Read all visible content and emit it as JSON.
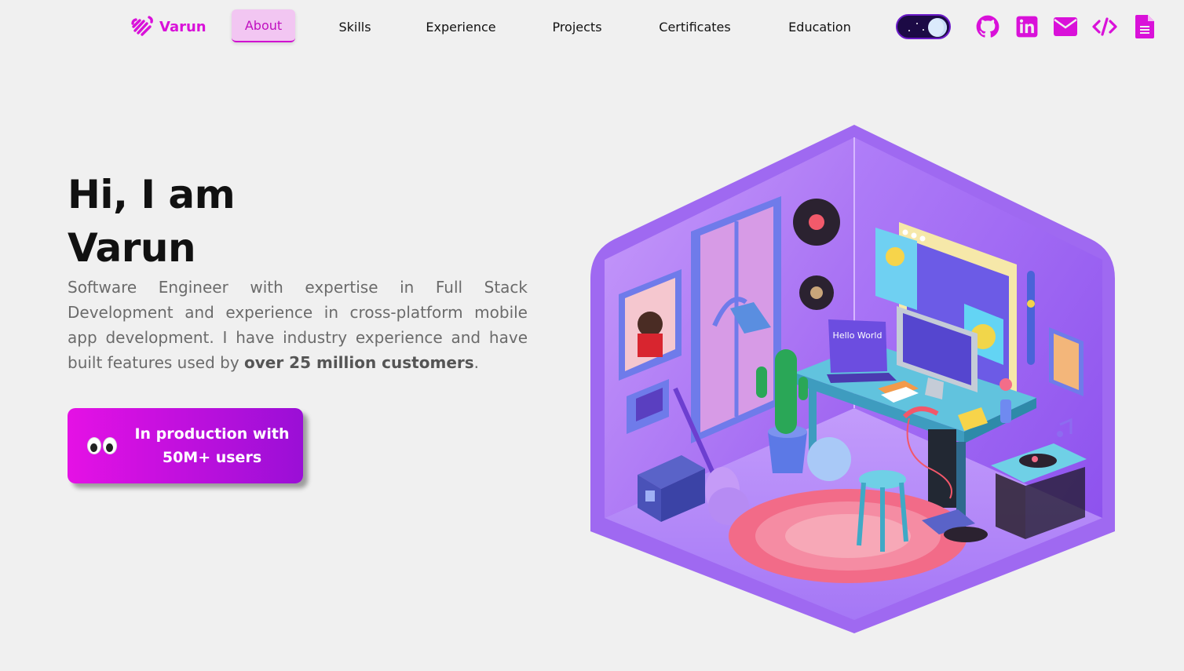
{
  "nav": {
    "logo_text": "Varun",
    "links": [
      {
        "label": "About",
        "active": true
      },
      {
        "label": "Skills"
      },
      {
        "label": "Experience"
      },
      {
        "label": "Projects"
      },
      {
        "label": "Certificates"
      },
      {
        "label": "Education"
      }
    ],
    "theme_toggle": {
      "state": "dark"
    },
    "social_icons": [
      "github-icon",
      "linkedin-icon",
      "mail-icon",
      "code-icon",
      "resume-icon"
    ]
  },
  "hero": {
    "greeting": "Hi, I am",
    "name": "Varun",
    "desc_main": "Software Engineer with expertise in Full Stack Development and experience in cross-platform mobile app development. I have industry experience and have built features used by ",
    "desc_bold": "over 25 million customers",
    "desc_end": ".",
    "cta_line1": "In production with",
    "cta_line2": "50M+ users",
    "illustration_text": "Hello World"
  },
  "colors": {
    "accent": "#d911d9",
    "cta_start": "#e511e5",
    "cta_end": "#9a0fd6",
    "background": "#f0f0f0"
  }
}
